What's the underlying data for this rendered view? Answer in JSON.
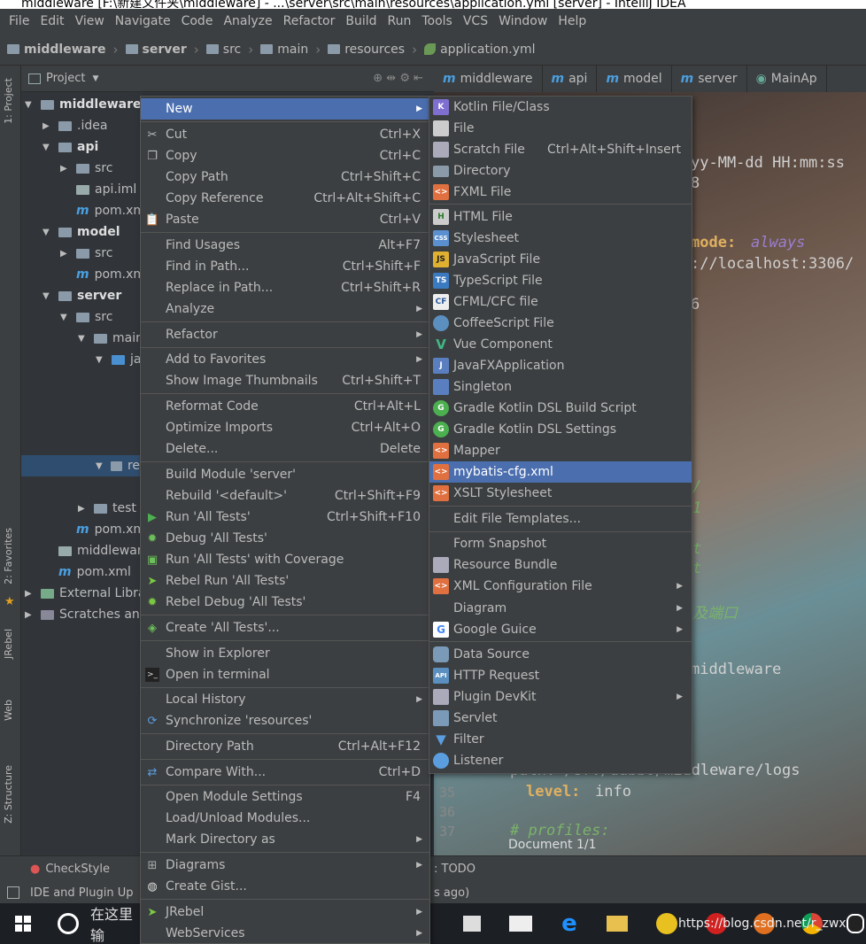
{
  "window": {
    "title": "middleware [F:\\新建文件夹\\middleware] - ...\\server\\src\\main\\resources\\application.yml [server] - IntelliJ IDEA"
  },
  "menubar": [
    "File",
    "Edit",
    "View",
    "Navigate",
    "Code",
    "Analyze",
    "Refactor",
    "Build",
    "Run",
    "Tools",
    "VCS",
    "Window",
    "Help"
  ],
  "breadcrumb": [
    "middleware",
    "server",
    "src",
    "main",
    "resources",
    "application.yml"
  ],
  "left_tabs": {
    "project": "1: Project",
    "favorites": "2: Favorites",
    "jrebel": "JRebel",
    "web": "Web",
    "structure": "Z: Structure"
  },
  "project_panel": {
    "title": "Project",
    "tree": [
      "middleware",
      ".idea",
      "api",
      "src",
      "api.iml",
      "pom.xml",
      "model",
      "src",
      "pom.xml",
      "server",
      "src",
      "main",
      "ja",
      "re",
      "test",
      "pom.xml",
      "middleware",
      "pom.xml",
      "External Libra",
      "Scratches and"
    ]
  },
  "editor_tabs": [
    "middleware",
    "api",
    "model",
    "server",
    "MainAp"
  ],
  "editor": {
    "lines": [
      "yy-MM-dd HH:mm:ss",
      "8",
      "mode:",
      "always",
      "://localhost:3306/",
      "6",
      "/",
      "1",
      "t",
      "t",
      "及端口",
      "middleware",
      "path: /srv/dubbo/middleware/logs",
      "level:",
      "info",
      "#  profiles:"
    ],
    "gutter": [
      "35",
      "36",
      "37"
    ]
  },
  "context_menu": {
    "items": [
      {
        "label": "New",
        "shortcut": "",
        "arrow": true
      },
      {
        "label": "Cut",
        "shortcut": "Ctrl+X"
      },
      {
        "label": "Copy",
        "shortcut": "Ctrl+C"
      },
      {
        "label": "Copy Path",
        "shortcut": "Ctrl+Shift+C"
      },
      {
        "label": "Copy Reference",
        "shortcut": "Ctrl+Alt+Shift+C"
      },
      {
        "label": "Paste",
        "shortcut": "Ctrl+V"
      },
      {
        "label": "Find Usages",
        "shortcut": "Alt+F7"
      },
      {
        "label": "Find in Path...",
        "shortcut": "Ctrl+Shift+F"
      },
      {
        "label": "Replace in Path...",
        "shortcut": "Ctrl+Shift+R"
      },
      {
        "label": "Analyze",
        "shortcut": "",
        "arrow": true
      },
      {
        "label": "Refactor",
        "shortcut": "",
        "arrow": true
      },
      {
        "label": "Add to Favorites",
        "shortcut": "",
        "arrow": true
      },
      {
        "label": "Show Image Thumbnails",
        "shortcut": "Ctrl+Shift+T"
      },
      {
        "label": "Reformat Code",
        "shortcut": "Ctrl+Alt+L"
      },
      {
        "label": "Optimize Imports",
        "shortcut": "Ctrl+Alt+O"
      },
      {
        "label": "Delete...",
        "shortcut": "Delete"
      },
      {
        "label": "Build Module 'server'",
        "shortcut": ""
      },
      {
        "label": "Rebuild '<default>'",
        "shortcut": "Ctrl+Shift+F9"
      },
      {
        "label": "Run 'All Tests'",
        "shortcut": "Ctrl+Shift+F10"
      },
      {
        "label": "Debug 'All Tests'",
        "shortcut": ""
      },
      {
        "label": "Run 'All Tests' with Coverage",
        "shortcut": ""
      },
      {
        "label": "Rebel Run 'All Tests'",
        "shortcut": ""
      },
      {
        "label": "Rebel Debug 'All Tests'",
        "shortcut": ""
      },
      {
        "label": "Create 'All Tests'...",
        "shortcut": ""
      },
      {
        "label": "Show in Explorer",
        "shortcut": ""
      },
      {
        "label": "Open in terminal",
        "shortcut": ""
      },
      {
        "label": "Local History",
        "shortcut": "",
        "arrow": true
      },
      {
        "label": "Synchronize 'resources'",
        "shortcut": ""
      },
      {
        "label": "Directory Path",
        "shortcut": "Ctrl+Alt+F12"
      },
      {
        "label": "Compare With...",
        "shortcut": "Ctrl+D"
      },
      {
        "label": "Open Module Settings",
        "shortcut": "F4"
      },
      {
        "label": "Load/Unload Modules...",
        "shortcut": ""
      },
      {
        "label": "Mark Directory as",
        "shortcut": "",
        "arrow": true
      },
      {
        "label": "Diagrams",
        "shortcut": "",
        "arrow": true
      },
      {
        "label": "Create Gist...",
        "shortcut": ""
      },
      {
        "label": "JRebel",
        "shortcut": "",
        "arrow": true
      },
      {
        "label": "WebServices",
        "shortcut": "",
        "arrow": true
      }
    ]
  },
  "new_submenu": {
    "items": [
      {
        "label": "Kotlin File/Class",
        "shortcut": "",
        "icon": "K"
      },
      {
        "label": "File",
        "shortcut": "",
        "icon": ""
      },
      {
        "label": "Scratch File",
        "shortcut": "Ctrl+Alt+Shift+Insert",
        "icon": ""
      },
      {
        "label": "Directory",
        "shortcut": "",
        "icon": ""
      },
      {
        "label": "FXML File",
        "shortcut": "",
        "icon": "<>"
      },
      {
        "label": "HTML File",
        "shortcut": "",
        "icon": "H"
      },
      {
        "label": "Stylesheet",
        "shortcut": "",
        "icon": "CSS"
      },
      {
        "label": "JavaScript File",
        "shortcut": "",
        "icon": "JS"
      },
      {
        "label": "TypeScript File",
        "shortcut": "",
        "icon": "TS"
      },
      {
        "label": "CFML/CFC file",
        "shortcut": "",
        "icon": "CF"
      },
      {
        "label": "CoffeeScript File",
        "shortcut": "",
        "icon": ""
      },
      {
        "label": "Vue Component",
        "shortcut": "",
        "icon": "V"
      },
      {
        "label": "JavaFXApplication",
        "shortcut": "",
        "icon": "J"
      },
      {
        "label": "Singleton",
        "shortcut": "",
        "icon": ""
      },
      {
        "label": "Gradle Kotlin DSL Build Script",
        "shortcut": "",
        "icon": "G"
      },
      {
        "label": "Gradle Kotlin DSL Settings",
        "shortcut": "",
        "icon": "G"
      },
      {
        "label": "Mapper",
        "shortcut": "",
        "icon": "<>"
      },
      {
        "label": "mybatis-cfg.xml",
        "shortcut": "",
        "icon": "<>"
      },
      {
        "label": "XSLT Stylesheet",
        "shortcut": "",
        "icon": "<>"
      },
      {
        "label": "Edit File Templates...",
        "shortcut": "",
        "icon": ""
      },
      {
        "label": "Form Snapshot",
        "shortcut": "",
        "icon": ""
      },
      {
        "label": "Resource Bundle",
        "shortcut": "",
        "icon": ""
      },
      {
        "label": "XML Configuration File",
        "shortcut": "",
        "icon": "<>",
        "arrow": true
      },
      {
        "label": "Diagram",
        "shortcut": "",
        "icon": "",
        "arrow": true
      },
      {
        "label": "Google Guice",
        "shortcut": "",
        "icon": "G",
        "arrow": true
      },
      {
        "label": "Data Source",
        "shortcut": "",
        "icon": ""
      },
      {
        "label": "HTTP Request",
        "shortcut": "",
        "icon": "API"
      },
      {
        "label": "Plugin DevKit",
        "shortcut": "",
        "icon": "",
        "arrow": true
      },
      {
        "label": "Servlet",
        "shortcut": "",
        "icon": ""
      },
      {
        "label": "Filter",
        "shortcut": "",
        "icon": ""
      },
      {
        "label": "Listener",
        "shortcut": "",
        "icon": ""
      }
    ]
  },
  "bottom_toolbar": {
    "checkstyle": "CheckStyle",
    "todo": ": TODO",
    "document": "Document 1/1"
  },
  "statusbar": {
    "text": "IDE and Plugin Up",
    "right": "s ago)"
  },
  "taskbar": {
    "search_text": "在这里输",
    "watermark": "https://blog.csdn.net/r_zwx"
  },
  "colors": {
    "menu_bg": "#3c3f41",
    "selection": "#4b6eaf",
    "editor_bg": "#2b2b2b"
  }
}
